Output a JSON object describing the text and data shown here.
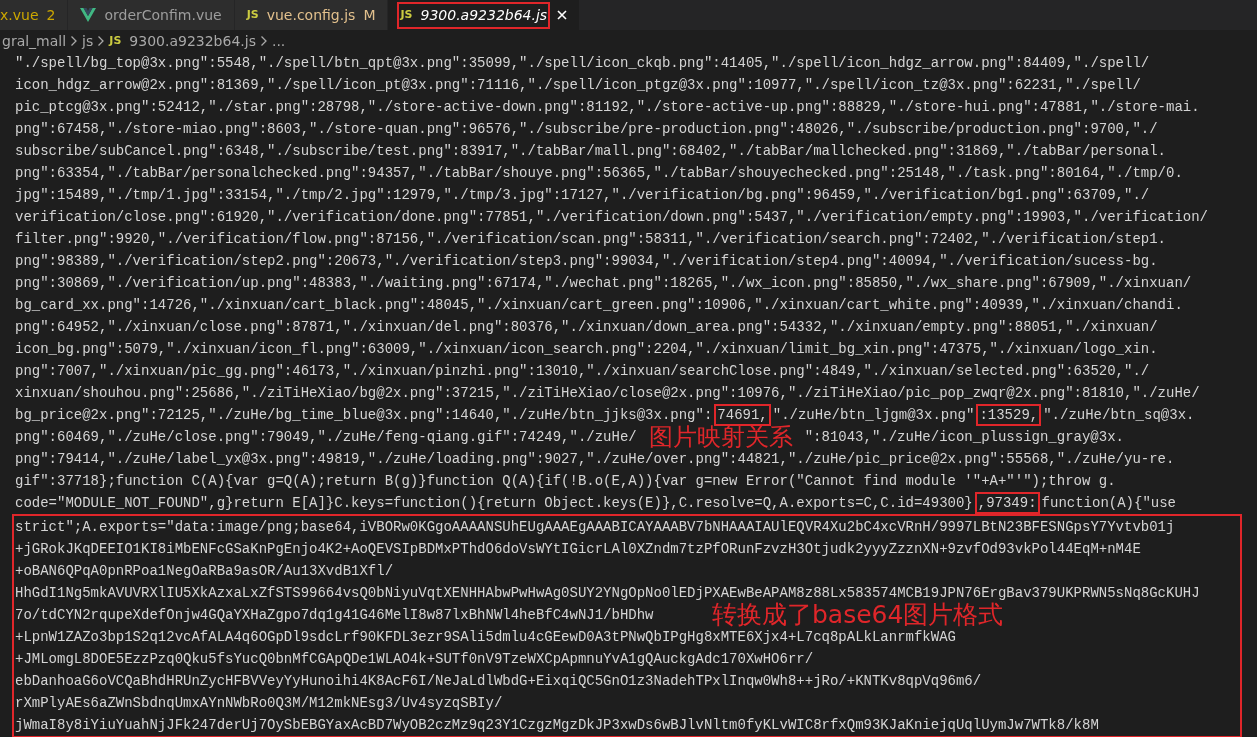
{
  "tabs": [
    {
      "label": "x.vue",
      "kind": "plain",
      "color": "#cca700",
      "decoration": "2",
      "selected": false,
      "preview": false,
      "highlighted": false
    },
    {
      "label": "orderConfim.vue",
      "kind": "vue",
      "selected": false,
      "preview": false,
      "highlighted": false
    },
    {
      "label": "vue.config.js",
      "kind": "js",
      "icon_label": "JS",
      "color": "#e2c08d",
      "decoration": "M",
      "selected": false,
      "preview": false,
      "highlighted": false
    },
    {
      "label": "9300.a9232b64.js",
      "kind": "js",
      "icon_label": "JS",
      "selected": true,
      "preview": true,
      "highlighted": true
    }
  ],
  "breadcrumb": [
    {
      "label": "gral_mall"
    },
    {
      "label": "js"
    },
    {
      "label": "9300.a9232b64.js",
      "icon_label": "JS"
    },
    {
      "label": "..."
    }
  ],
  "lines": [
    {
      "text": "\"./spell/bg_top@3x.png\":5548,\"./spell/btn_qpt@3x.png\":35099,\"./spell/icon_ckqb.png\":41405,\"./spell/icon_hdgz_arrow.png\":84409,\"./spell/"
    },
    {
      "text": "icon_hdgz_arrow@2x.png\":81369,\"./spell/icon_pt@3x.png\":71116,\"./spell/icon_ptgz@3x.png\":10977,\"./spell/icon_tz@3x.png\":62231,\"./spell/"
    },
    {
      "text": "pic_ptcg@3x.png\":52412,\"./star.png\":28798,\"./store-active-down.png\":81192,\"./store-active-up.png\":88829,\"./store-hui.png\":47881,\"./store-mai."
    },
    {
      "text": "png\":67458,\"./store-miao.png\":8603,\"./store-quan.png\":96576,\"./subscribe/pre-production.png\":48026,\"./subscribe/production.png\":9700,\"./"
    },
    {
      "text": "subscribe/subCancel.png\":6348,\"./subscribe/test.png\":83917,\"./tabBar/mall.png\":68402,\"./tabBar/mallchecked.png\":31869,\"./tabBar/personal."
    },
    {
      "text": "png\":63354,\"./tabBar/personalchecked.png\":94357,\"./tabBar/shouye.png\":56365,\"./tabBar/shouyechecked.png\":25148,\"./task.png\":80164,\"./tmp/0."
    },
    {
      "text": "jpg\":15489,\"./tmp/1.jpg\":33154,\"./tmp/2.jpg\":12979,\"./tmp/3.jpg\":17127,\"./verification/bg.png\":96459,\"./verification/bg1.png\":63709,\"./"
    },
    {
      "text": "verification/close.png\":61920,\"./verification/done.png\":77851,\"./verification/down.png\":5437,\"./verification/empty.png\":19903,\"./verification/"
    },
    {
      "text": "filter.png\":9920,\"./verification/flow.png\":87156,\"./verification/scan.png\":58311,\"./verification/search.png\":72402,\"./verification/step1."
    },
    {
      "text": "png\":98389,\"./verification/step2.png\":20673,\"./verification/step3.png\":99034,\"./verification/step4.png\":40094,\"./verification/sucess-bg."
    },
    {
      "text": "png\":30869,\"./verification/up.png\":48383,\"./waiting.png\":67174,\"./wechat.png\":18265,\"./wx_icon.png\":85850,\"./wx_share.png\":67909,\"./xinxuan/"
    },
    {
      "text": "bg_card_xx.png\":14726,\"./xinxuan/cart_black.png\":48045,\"./xinxuan/cart_green.png\":10906,\"./xinxuan/cart_white.png\":40939,\"./xinxuan/chandi."
    },
    {
      "text": "png\":64952,\"./xinxuan/close.png\":87871,\"./xinxuan/del.png\":80376,\"./xinxuan/down_area.png\":54332,\"./xinxuan/empty.png\":88051,\"./xinxuan/"
    },
    {
      "text": "icon_bg.png\":5079,\"./xinxuan/icon_fl.png\":63009,\"./xinxuan/icon_search.png\":2204,\"./xinxuan/limit_bg_xin.png\":47375,\"./xinxuan/logo_xin."
    },
    {
      "text": "png\":7007,\"./xinxuan/pic_gg.png\":46173,\"./xinxuan/pinzhi.png\":13010,\"./xinxuan/searchClose.png\":4849,\"./xinxuan/selected.png\":63520,\"./"
    },
    {
      "text": "xinxuan/shouhou.png\":25686,\"./ziTiHeXiao/bg@2x.png\":37215,\"./ziTiHeXiao/close@2x.png\":10976,\"./ziTiHeXiao/pic_pop_zwqr@2x.png\":81810,\"./zuHe/"
    },
    {
      "segments": [
        {
          "text": "bg_price@2x.png\":72125,\"./zuHe/bg_time_blue@3x.png\":14640,\"./zuHe/btn_jjks@3x.png\":",
          "boxed": false
        },
        {
          "text": "74691,",
          "boxed": true
        },
        {
          "text": "\"./zuHe/btn_ljgm@3x.png\"",
          "boxed": false
        },
        {
          "text": ":13529,",
          "boxed": true
        },
        {
          "text": "\"./zuHe/btn_sq@3x.",
          "boxed": false
        }
      ]
    },
    {
      "segments": [
        {
          "text": "png\":60469,\"./zuHe/close.png\":79049,\"./zuHe/feng-qiang.gif\":74249,\"./zuHe/",
          "boxed": false
        },
        {
          "note": "图片映射关系"
        },
        {
          "text": "\":81043,\"./zuHe/icon_plussign_gray@3x.",
          "boxed": false
        }
      ]
    },
    {
      "text": "png\":79414,\"./zuHe/label_yx@3x.png\":49819,\"./zuHe/loading.png\":9027,\"./zuHe/over.png\":44821,\"./zuHe/pic_price@2x.png\":55568,\"./zuHe/yu-re."
    },
    {
      "text": "gif\":37718};function C(A){var g=Q(A);return B(g)}function Q(A){if(!B.o(E,A)){var g=new Error(\"Cannot find module '\"+A+\"'\");throw g."
    },
    {
      "segments": [
        {
          "text": "code=\"MODULE_NOT_FOUND\",g}return E[A]}C.keys=function(){return Object.keys(E)},C.resolve=Q,A.exports=C,C.id=49300}",
          "boxed": false
        },
        {
          "text": ",97349:",
          "boxed": true
        },
        {
          "text": "function(A){\"use",
          "boxed": false
        }
      ]
    }
  ],
  "boxed_block": {
    "lines": [
      {
        "text": "strict\";A.exports=\"data:image/png;base64,iVBORw0KGgoAAAANSUhEUgAAAEgAAABICAYAAABV7bNHAAAIAUlEQVR4Xu2bC4xcVRnH/9997LBtN23BFESNGpsY7Yvtvb01j"
      },
      {
        "text": "+jGRokJKqDEEIO1KI8iMbENFcGSaKnPgEnjo4K2+AoQEVSIpBDMxPThdO6doVsWYtIGicrLAl0XZndm7tzPfORunFzvzH3Otjudk2yyyZzznXN+9zvfOd93vkPol44EqM+nM4E"
      },
      {
        "text": "+oBAN6QPqA0pnRPoa1NegOaRBa9asOR/Au13XvdB1Xfl/"
      },
      {
        "text": "HhGdI1Ng5mkAVUVRXlIU5XkAzxaLxZfSTS99664vsQ0bNiyuVqtXENHHAbwPwHwAg0SUY2YNgOpNo0lEDjPXAEwBeAPAM8z88Lx583574MCB19JPN76ErgBav379UKPRWN5sNq8GcKUHJ"
      },
      {
        "text": "7o/tdCYN2rqupeXdefOnjw4GQaYXHaZgpo7dq1g41G46MelI8w87lxBhNWl4heBfC4wNJ1/bHDhw",
        "note": "转换成了base64图片格式"
      },
      {
        "text": "+LpnW1ZAZo3bp1S2q12vcAfALA4q6OGpDl9sdcLrf90KFDL3ezr9SAli5dmlu4cGEewD0A3tPNwQbIPgHg8xMTE6Xjx4+L7cq8pALkLanrmfkWAG"
      },
      {
        "text": "+JMLomgL8DOE5EzzPzq0Qku5fsYucQ0bnMfCGApQDe1WLAO4k+SUTf0nV9TzeWXCpApmnuYvA1gQAuckgAdc170XwHO6rr/"
      },
      {
        "text": "ebDanhoaG6oVCQaBhdHRUnZycHFBVVeyYyHunoihi4K8AcF6I/NeJaLdlWbdG+EixqiQC5GnO1z3NadehTPxlInqw0Wh8++jRo/+KNTKv8qpVq96m6/"
      },
      {
        "text": "rXmPlyAEs6aZWnSbdnqUmxAYnNWbRo0Q3M/M12mkNEsg3/Uv4syzqSBIy/"
      },
      {
        "text": "jWmaI8y8iYiuYuahNjJFk247derUj7OySbEBGYaxAcBD7WyOB2czMz9q23Y1CzgzMgzDkJP3xwDs6wBJlvNltm0fyKLvWIC8rfxQm93KJaKniejqUqlUymJw7WTk8/k8M"
      }
    ]
  }
}
